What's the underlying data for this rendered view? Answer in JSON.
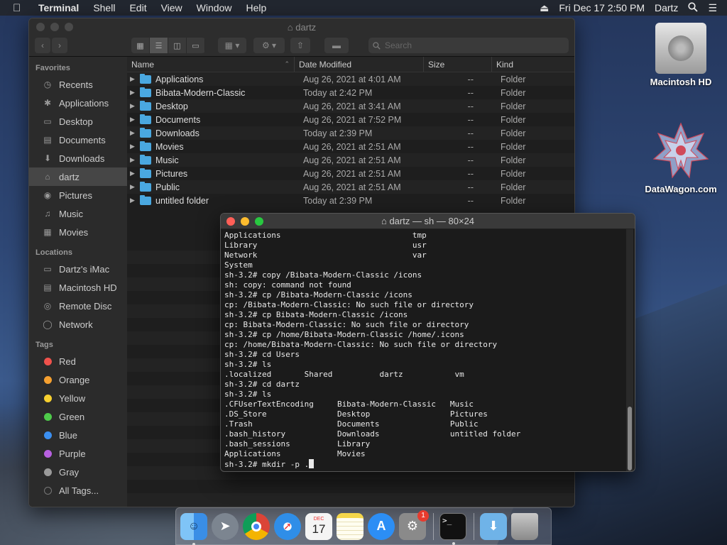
{
  "menubar": {
    "app_name": "Terminal",
    "items": [
      "Shell",
      "Edit",
      "View",
      "Window",
      "Help"
    ],
    "datetime": "Fri Dec 17  2:50 PM",
    "user": "Dartz"
  },
  "finder": {
    "title": "dartz",
    "search_placeholder": "Search",
    "sidebar": {
      "favorites_heading": "Favorites",
      "favorites": [
        {
          "label": "Recents",
          "icon": "clock-icon"
        },
        {
          "label": "Applications",
          "icon": "applications-icon"
        },
        {
          "label": "Desktop",
          "icon": "desktop-icon"
        },
        {
          "label": "Documents",
          "icon": "document-icon"
        },
        {
          "label": "Downloads",
          "icon": "download-icon"
        },
        {
          "label": "dartz",
          "icon": "home-icon"
        },
        {
          "label": "Pictures",
          "icon": "camera-icon"
        },
        {
          "label": "Music",
          "icon": "music-icon"
        },
        {
          "label": "Movies",
          "icon": "film-icon"
        }
      ],
      "locations_heading": "Locations",
      "locations": [
        {
          "label": "Dartz's iMac",
          "icon": "imac-icon"
        },
        {
          "label": "Macintosh HD",
          "icon": "disk-icon"
        },
        {
          "label": "Remote Disc",
          "icon": "disc-icon"
        },
        {
          "label": "Network",
          "icon": "globe-icon"
        }
      ],
      "tags_heading": "Tags",
      "tags": [
        {
          "label": "Red",
          "color": "#f0524c"
        },
        {
          "label": "Orange",
          "color": "#f5a030"
        },
        {
          "label": "Yellow",
          "color": "#f7d02f"
        },
        {
          "label": "Green",
          "color": "#4ecb4a"
        },
        {
          "label": "Blue",
          "color": "#3b8ff0"
        },
        {
          "label": "Purple",
          "color": "#b760e0"
        },
        {
          "label": "Gray",
          "color": "#9a9a9a"
        }
      ],
      "all_tags": "All Tags..."
    },
    "columns": {
      "name": "Name",
      "date": "Date Modified",
      "size": "Size",
      "kind": "Kind"
    },
    "rows": [
      {
        "name": "Applications",
        "date": "Aug 26, 2021 at 4:01 AM",
        "size": "--",
        "kind": "Folder"
      },
      {
        "name": "Bibata-Modern-Classic",
        "date": "Today at 2:42 PM",
        "size": "--",
        "kind": "Folder"
      },
      {
        "name": "Desktop",
        "date": "Aug 26, 2021 at 3:41 AM",
        "size": "--",
        "kind": "Folder"
      },
      {
        "name": "Documents",
        "date": "Aug 26, 2021 at 7:52 PM",
        "size": "--",
        "kind": "Folder"
      },
      {
        "name": "Downloads",
        "date": "Today at 2:39 PM",
        "size": "--",
        "kind": "Folder"
      },
      {
        "name": "Movies",
        "date": "Aug 26, 2021 at 2:51 AM",
        "size": "--",
        "kind": "Folder"
      },
      {
        "name": "Music",
        "date": "Aug 26, 2021 at 2:51 AM",
        "size": "--",
        "kind": "Folder"
      },
      {
        "name": "Pictures",
        "date": "Aug 26, 2021 at 2:51 AM",
        "size": "--",
        "kind": "Folder"
      },
      {
        "name": "Public",
        "date": "Aug 26, 2021 at 2:51 AM",
        "size": "--",
        "kind": "Folder"
      },
      {
        "name": "untitled folder",
        "date": "Today at 2:39 PM",
        "size": "--",
        "kind": "Folder"
      }
    ]
  },
  "terminal": {
    "title": "dartz — sh — 80×24",
    "lines": [
      "Applications                            tmp",
      "Library                                 usr",
      "Network                                 var",
      "System",
      "sh-3.2# copy /Bibata-Modern-Classic /icons",
      "sh: copy: command not found",
      "sh-3.2# cp /Bibata-Modern-Classic /icons",
      "cp: /Bibata-Modern-Classic: No such file or directory",
      "sh-3.2# cp Bibata-Modern-Classic /icons",
      "cp: Bibata-Modern-Classic: No such file or directory",
      "sh-3.2# cp /home/Bibata-Modern-Classic /home/.icons",
      "cp: /home/Bibata-Modern-Classic: No such file or directory",
      "sh-3.2# cd Users",
      "sh-3.2# ls",
      ".localized       Shared          dartz           vm",
      "sh-3.2# cd dartz",
      "sh-3.2# ls",
      ".CFUserTextEncoding     Bibata-Modern-Classic   Music",
      ".DS_Store               Desktop                 Pictures",
      ".Trash                  Documents               Public",
      ".bash_history           Downloads               untitled folder",
      ".bash_sessions          Library",
      "Applications            Movies"
    ],
    "prompt": "sh-3.2# mkdir -p ."
  },
  "desktop": {
    "icons": [
      {
        "label": "Macintosh HD",
        "icon": "hard-drive-icon"
      },
      {
        "label": "DataWagon.com",
        "icon": "star-logo-icon"
      }
    ]
  },
  "dock": {
    "apps": [
      {
        "name": "Finder",
        "icon": "finder-icon",
        "color": "#3a8ee6"
      },
      {
        "name": "Launchpad",
        "icon": "rocket-icon",
        "color": "#7c8590"
      },
      {
        "name": "Chrome",
        "icon": "chrome-icon",
        "color": "#dcdcdc"
      },
      {
        "name": "Safari",
        "icon": "safari-icon",
        "color": "#2f8ee8"
      },
      {
        "name": "Calendar",
        "icon": "calendar-icon",
        "color": "#f4f4f4"
      },
      {
        "name": "Notes",
        "icon": "notes-icon",
        "color": "#f5d64a"
      },
      {
        "name": "App Store",
        "icon": "app-store-icon",
        "color": "#2c8ef5"
      },
      {
        "name": "System Preferences",
        "icon": "gear-icon",
        "color": "#8a8a8a"
      }
    ],
    "system_prefs_badge": "1",
    "calendar_month": "DEC",
    "calendar_day": "17"
  }
}
